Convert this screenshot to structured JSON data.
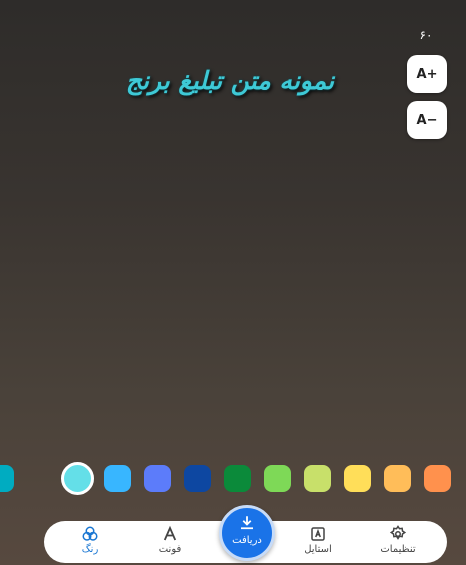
{
  "editor": {
    "font_size": "۶۰",
    "increase_label": "A+",
    "decrease_label": "A−",
    "sample_text": "نمونه متن تبلیغ برنج",
    "text_color": "#3ec9d6"
  },
  "palette": {
    "selected_index": 1,
    "colors": [
      "#00acc1",
      "#64dfe8",
      "#38b6ff",
      "#5c7cfa",
      "#0d47a1",
      "#0b8a3a",
      "#7ed957",
      "#c8e06a",
      "#ffde59",
      "#ffbd59",
      "#ff914d"
    ]
  },
  "nav": {
    "settings_label": "تنظیمات",
    "style_label": "استایل",
    "download_label": "دریافت",
    "font_label": "فونت",
    "color_label": "رنگ",
    "active_color": "#1976d2"
  }
}
